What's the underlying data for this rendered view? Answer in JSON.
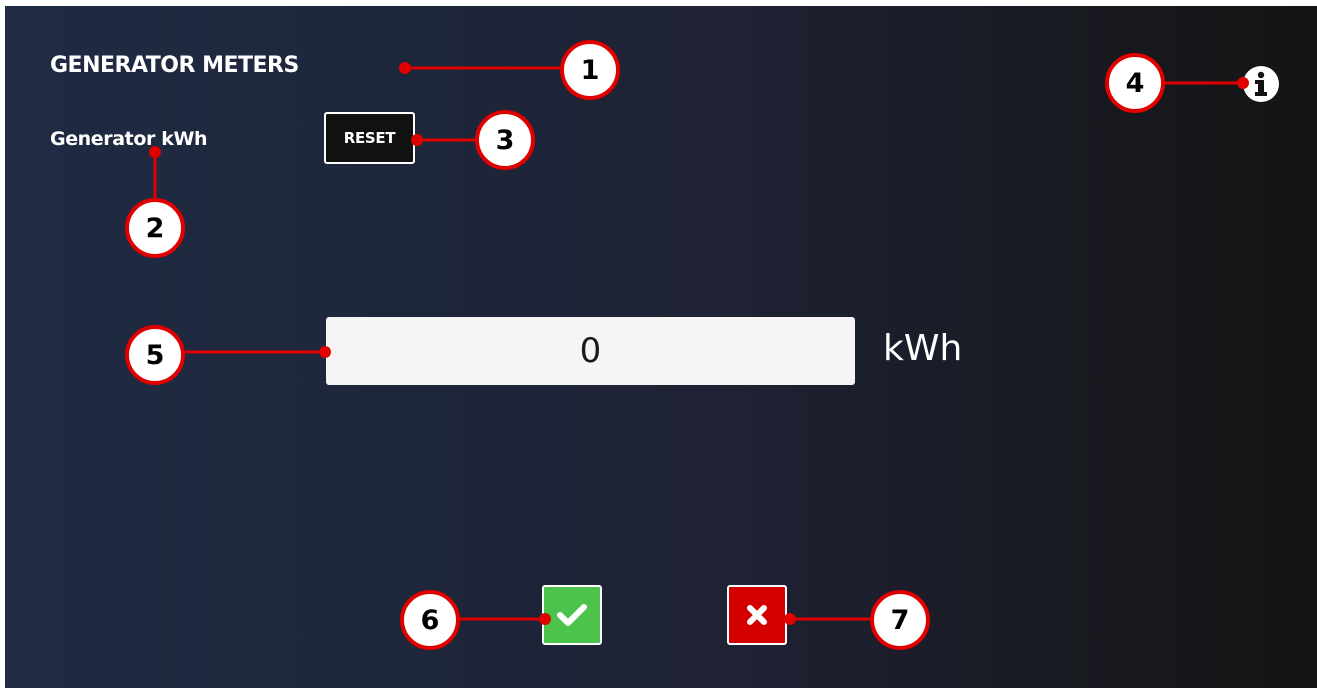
{
  "page": {
    "title": "GENERATOR METERS",
    "meter_label": "Generator kWh",
    "reset_label": "RESET",
    "info_icon": "info-icon"
  },
  "meter": {
    "value": "0",
    "unit": "kWh"
  },
  "actions": {
    "confirm_icon": "check-icon",
    "confirm_color": "#4cc34a",
    "cancel_icon": "close-icon",
    "cancel_color": "#d40000"
  },
  "annotations": {
    "accent_color": "#e00000",
    "markers": [
      "1",
      "2",
      "3",
      "4",
      "5",
      "6",
      "7"
    ]
  }
}
